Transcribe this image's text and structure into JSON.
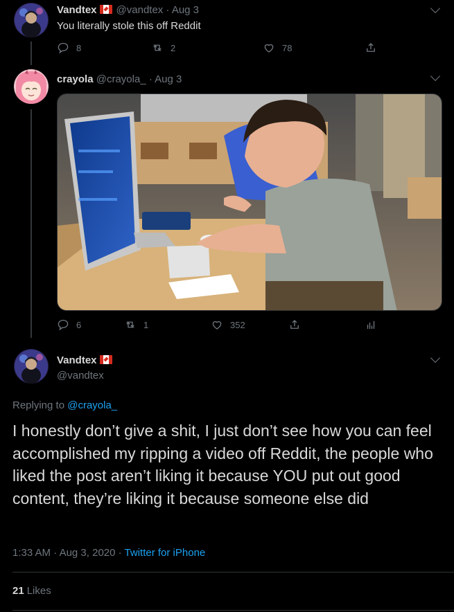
{
  "tweet1": {
    "display_name": "Vandtex",
    "handle": "@vandtex",
    "dot": "·",
    "date": "Aug 3",
    "text": "You literally stole this off Reddit",
    "replies": "8",
    "retweets": "2",
    "likes": "78"
  },
  "tweet2": {
    "display_name": "crayola",
    "handle": "@crayola_",
    "dot": "·",
    "date": "Aug 3",
    "replies": "6",
    "retweets": "1",
    "likes": "352"
  },
  "main": {
    "display_name": "Vandtex",
    "handle": "@vandtex",
    "replying_to_prefix": "Replying to",
    "replying_to_handle": "@crayola_",
    "text": "I honestly don’t give a shit, I just don’t see how you can feel accomplished my ripping a video off Reddit, the people who liked the post aren’t liking it because YOU put out good content, they’re liking it because someone else did",
    "time": "1:33 AM",
    "dot1": "·",
    "date": "Aug 3, 2020",
    "dot2": "·",
    "source": "Twitter for iPhone",
    "like_count": "21",
    "like_label": "Likes"
  },
  "icons": [
    "reply-icon",
    "retweet-icon",
    "like-icon",
    "share-icon",
    "analytics-icon",
    "chevron-down-icon",
    "canada-flag-icon"
  ],
  "colors": {
    "background": "#000000",
    "text": "#d9d9d9",
    "muted": "#6e767d",
    "link": "#1da1f2",
    "divider": "#2f3336"
  }
}
